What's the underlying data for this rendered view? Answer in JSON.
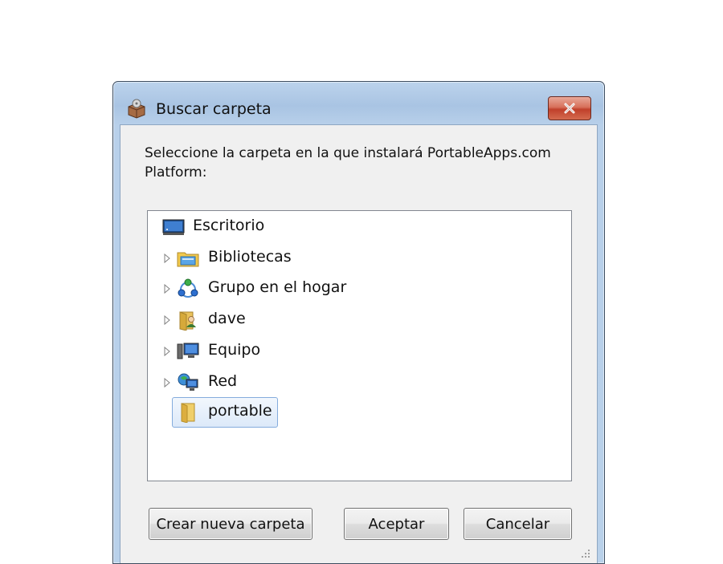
{
  "window": {
    "title": "Buscar carpeta",
    "close_label": "✕"
  },
  "dialog": {
    "prompt": "Seleccione la carpeta en la que instalará PortableApps.com Platform:"
  },
  "tree": {
    "items": [
      {
        "label": "Escritorio",
        "icon": "desktop-icon",
        "expandable": false
      },
      {
        "label": "Bibliotecas",
        "icon": "libraries-icon",
        "expandable": true
      },
      {
        "label": "Grupo en el hogar",
        "icon": "homegroup-icon",
        "expandable": true
      },
      {
        "label": "dave",
        "icon": "user-folder-icon",
        "expandable": true
      },
      {
        "label": "Equipo",
        "icon": "computer-icon",
        "expandable": true
      },
      {
        "label": "Red",
        "icon": "network-icon",
        "expandable": true
      },
      {
        "label": "portable",
        "icon": "folder-icon",
        "expandable": false,
        "selected": true
      }
    ]
  },
  "buttons": {
    "new_folder": "Crear nueva carpeta",
    "ok": "Aceptar",
    "cancel": "Cancelar"
  },
  "colors": {
    "close_button": "#c0402b",
    "selection": "#dce9f9",
    "frame": "#a9c4e3"
  }
}
